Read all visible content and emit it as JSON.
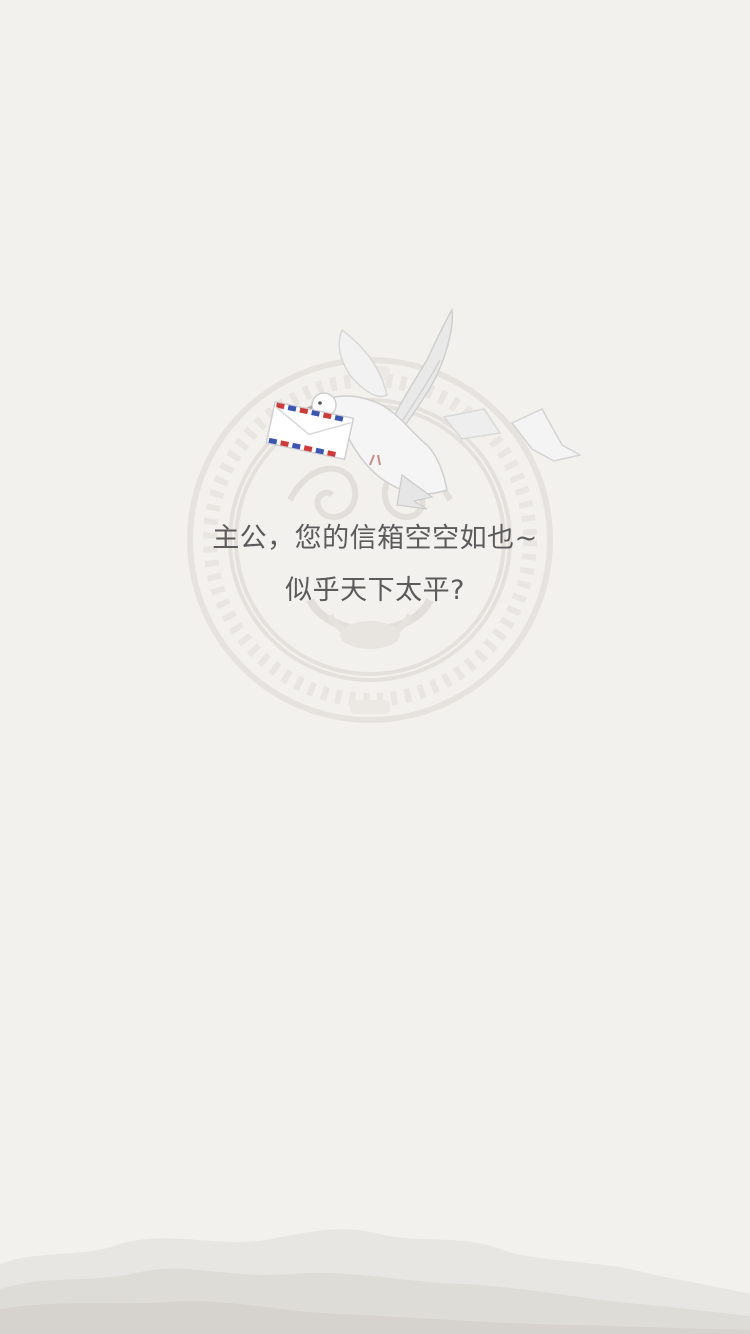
{
  "empty_state": {
    "line1": "主公，您的信箱空空如也~",
    "line2": "似乎天下太平?",
    "icon": "carrier-pigeon-with-letter-icon",
    "decoration": "ornamental-medallion-icon"
  },
  "colors": {
    "background": "#f3f1ed",
    "text": "#5b5b5b",
    "airmail_red": "#d23a3a",
    "airmail_blue": "#3a55b4"
  }
}
